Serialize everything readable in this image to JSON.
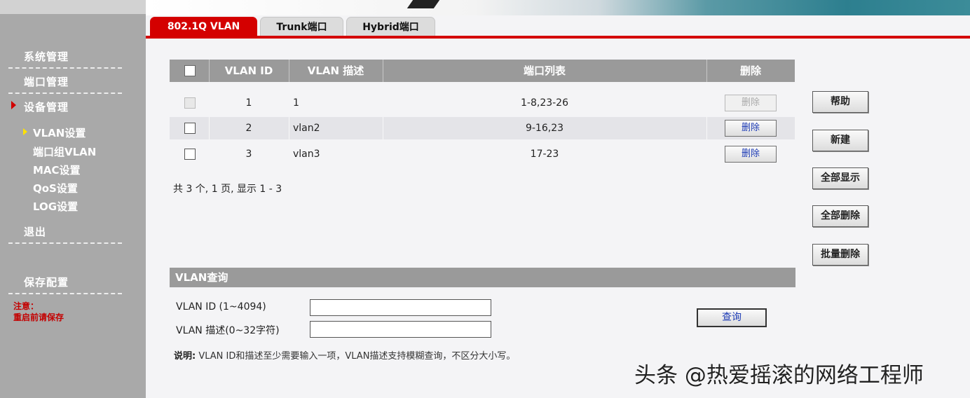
{
  "tabs": [
    {
      "label": "802.1Q VLAN"
    },
    {
      "label": "Trunk端口"
    },
    {
      "label": "Hybrid端口"
    }
  ],
  "sidebar": {
    "items": [
      {
        "label": "系统管理"
      },
      {
        "label": "端口管理"
      },
      {
        "label": "设备管理"
      },
      {
        "label": "VLAN设置"
      },
      {
        "label": "端口组VLAN"
      },
      {
        "label": "MAC设置"
      },
      {
        "label": "QoS设置"
      },
      {
        "label": "LOG设置"
      },
      {
        "label": "退出"
      },
      {
        "label": "保存配置"
      }
    ],
    "note_line1": "注意：",
    "note_line2": "重启前请保存"
  },
  "table": {
    "headers": {
      "vlan_id": "VLAN ID",
      "vlan_desc": "VLAN 描述",
      "ports": "端口列表",
      "delete": "删除"
    },
    "rows": [
      {
        "id": "1",
        "desc": "1",
        "ports": "1-8,23-26",
        "delete": "删除"
      },
      {
        "id": "2",
        "desc": "vlan2",
        "ports": "9-16,23",
        "delete": "删除"
      },
      {
        "id": "3",
        "desc": "vlan3",
        "ports": "17-23",
        "delete": "删除"
      }
    ],
    "summary": "共 3 个, 1 页, 显示 1 - 3"
  },
  "right_buttons": {
    "help": "帮助",
    "new": "新建",
    "show_all": "全部显示",
    "delete_all": "全部删除",
    "batch_delete": "批量删除"
  },
  "query": {
    "title": "VLAN查询",
    "id_label": "VLAN ID (1~4094)",
    "id_value": "",
    "desc_label": "VLAN 描述(0~32字符)",
    "desc_value": "",
    "button": "查询",
    "note_bold": "说明:",
    "note_text": " VLAN ID和描述至少需要输入一项，VLAN描述支持模糊查询，不区分大小写。"
  },
  "watermark": "头条 @热爱摇滚的网络工程师",
  "colors": {
    "accent": "#d40000",
    "sidebar": "#a9a9a9",
    "header_gray": "#9a9a9a",
    "link_blue": "#1d3bb5"
  }
}
